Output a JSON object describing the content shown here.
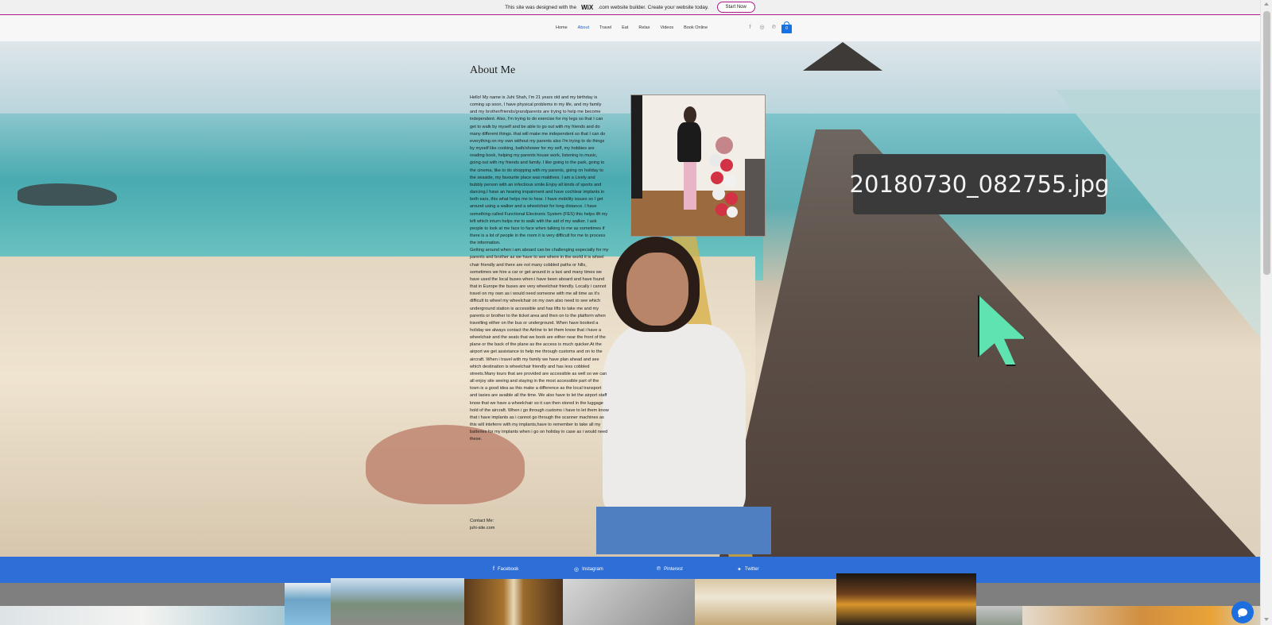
{
  "banner": {
    "text_before": "This site was designed with the",
    "logo": "WiX",
    "text_after": ".com website builder. Create your website today.",
    "button": "Start Now"
  },
  "nav": {
    "items": [
      {
        "label": "Home",
        "active": false
      },
      {
        "label": "About",
        "active": true
      },
      {
        "label": "Travel",
        "active": false
      },
      {
        "label": "Eat",
        "active": false
      },
      {
        "label": "Relax",
        "active": false
      },
      {
        "label": "Videos",
        "active": false
      },
      {
        "label": "Book Online",
        "active": false
      }
    ],
    "social_icons": [
      "facebook-icon",
      "instagram-icon",
      "pinterest-icon"
    ],
    "cart_count": "0"
  },
  "about": {
    "title": "About Me",
    "body": "Hello! My name is Juhi Shah, I'm 21 years old and my birthday is coming up soon, I have physical problems in my life, and my family and my brother/friends/grandparents are trying to help me become independent. Also, I'm trying to do exercise for my legs so that I can get to walk by myself and be able to go out with my friends and do many different things. that will make me independent so that I can do everything on my own without my parents also I'm trying to do things by myself like cooking, bath/shower for my self, my hobbies are reading book, helping my parents house work, listening to music, going out with my friends and family. I like going to the park, going to the cinema, like to do shopping with my parents, going on holiday to the seaside, my favourite place was maldives. I am a Lively and bubbly person with an infectious smile.Enjoy all kinds of sports and dancing.I have an hearing impairment and have cochlear implants in both ears, this what helps me to hear. I have mobility issues so I get around using a walker and a wheelchair for long distance. I have something called Functional Electronic System (FES) this helps lift my left which inturn helps me to walk with the aid of my walker. I ask people to look at me face to face when talking to me as sometimes if there is a lot of people in the room it is very difficult for me to process the information.\nGetting around when i am aboard can be challenging especially for my parents and brother as we have to see where in the world it is wheel chair friendly and there are not many cobbled paths or hills, sometimes we hire a car or get around in a taxi and many times we have used the local buses when i have been aboard and have found that in Europe the buses are very wheelchair friendly. Locally i cannot travel on my own as i would need someone with me all time as it's difficult to wheel my wheelchair on my own also need to see which underground station is accessible and has lifts to take me and my parents or brother to the ticket area and then on to the platform when travelling either on the bus or underground. When have booked a holiday we always contact the Airline to let them know that i have a wheelchair and the seats that we book are either near the front of the plane or the back of the plane as the access is much quicker.At the airport we get assistance to help me through customs and on to the aircraft. When i travel with my family we have plan ahead and see which destination is wheelchair friendly and has less cobbled streets.Many tours that are provided are accessible as well so we can all enjoy site seeing and staying in the most accessible part of the town is a good idea as this make a difference as the local transport and taxies are avaible all the time. We also have to let the airport staff know that we have a wheelchair so it can then stored in the luggage hold of the aircraft. When i go through customs i have to let them know that i have implants as i cannot go through the scanner machines as this will inteferre with my implants,have to remember to take all my batteries for my implants when i go on holiday in case as i would need these.",
    "contact_label": "Contact Me:",
    "contact_site": "juhi-site.com"
  },
  "hero": {
    "filename_overlay": "20180730_082755.jpg"
  },
  "social_bar": {
    "items": [
      {
        "icon": "facebook-icon",
        "label": "Facebook"
      },
      {
        "icon": "instagram-icon",
        "label": "Instagram"
      },
      {
        "icon": "pinterest-icon",
        "label": "Pinterest"
      },
      {
        "icon": "twitter-icon",
        "label": "Twitter"
      }
    ]
  },
  "colors": {
    "accent": "#2d6ed7",
    "wix_border": "#b21a8a",
    "active_nav": "#1c63c5"
  }
}
